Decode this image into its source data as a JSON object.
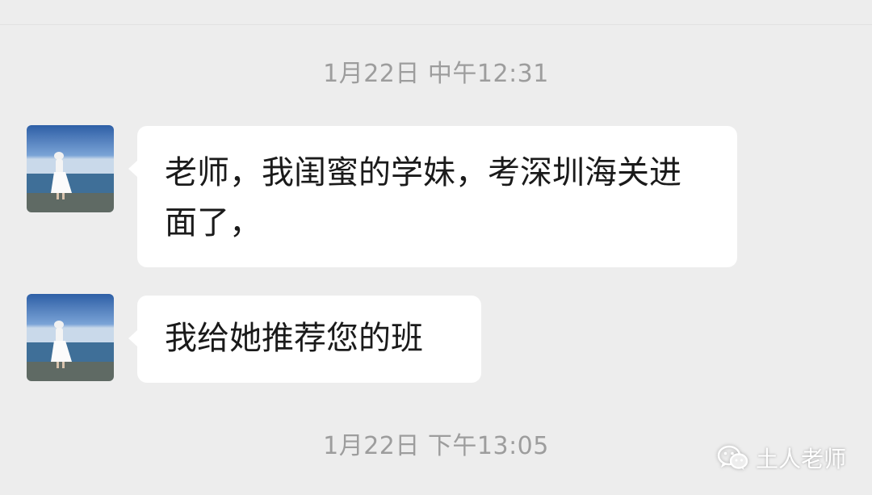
{
  "chat": {
    "timestamp_1": "1月22日 中午12:31",
    "timestamp_2": "1月22日 下午13:05",
    "messages": [
      {
        "text": "老师，我闺蜜的学妹，考深圳海关进面了，"
      },
      {
        "text": "我给她推荐您的班"
      }
    ]
  },
  "watermark": {
    "icon": "wechat-icon",
    "text": "土人老师"
  },
  "colors": {
    "background": "#ededed",
    "bubble": "#ffffff",
    "timestamp": "#9d9d9d",
    "message_text": "#1a1a1a"
  }
}
